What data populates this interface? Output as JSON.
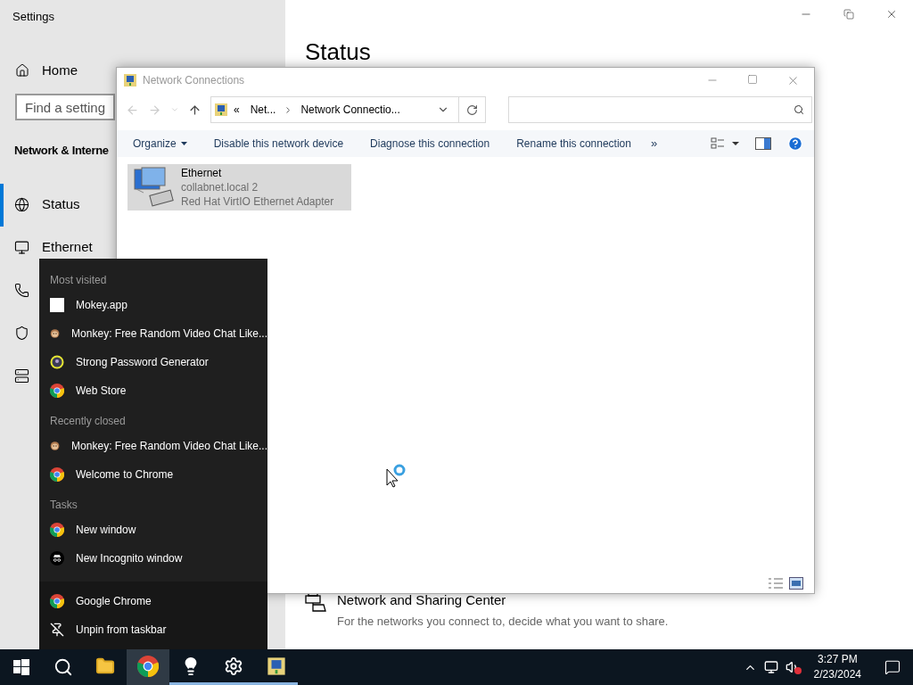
{
  "settings": {
    "title": "Settings",
    "home": "Home",
    "search": {
      "placeholder": "Find a setting"
    },
    "section": "Network & Interne",
    "items": [
      {
        "kind": "globe",
        "label": "Status",
        "selected": true
      },
      {
        "kind": "ethernet",
        "label": "Ethernet",
        "selected": false
      },
      {
        "kind": "dialup",
        "selected": false
      },
      {
        "kind": "vpn",
        "selected": false
      },
      {
        "kind": "proxy",
        "selected": false
      }
    ],
    "heading": "Status",
    "sharing": {
      "title": "Network and Sharing Center",
      "description": "For the networks you connect to, decide what you want to share."
    }
  },
  "network_window": {
    "title": "Network Connections",
    "address": {
      "overflow": "«",
      "crumbs": [
        "Net...",
        "Network Connectio..."
      ]
    },
    "toolbar": [
      "Organize",
      "Disable this network device",
      "Diagnose this connection",
      "Rename this connection"
    ],
    "more": "»",
    "items": [
      {
        "name": "Ethernet",
        "network": "collabnet.local 2",
        "adapter": "Red Hat VirtIO Ethernet Adapter",
        "selected": true
      }
    ]
  },
  "jump_list": {
    "sections": [
      {
        "heading": "Most visited",
        "items": [
          {
            "kind": "blank",
            "label": "Mokey.app"
          },
          {
            "kind": "monkey",
            "label": "Monkey: Free Random Video Chat Like..."
          },
          {
            "kind": "password",
            "label": "Strong Password Generator"
          },
          {
            "kind": "chrome",
            "label": "Web Store"
          }
        ]
      },
      {
        "heading": "Recently closed",
        "items": [
          {
            "kind": "monkey",
            "label": "Monkey: Free Random Video Chat Like..."
          },
          {
            "kind": "chrome",
            "label": "Welcome to Chrome"
          }
        ]
      },
      {
        "heading": "Tasks",
        "items": [
          {
            "kind": "chrome",
            "label": "New window"
          },
          {
            "kind": "incognito",
            "label": "New Incognito window"
          }
        ]
      }
    ],
    "footer": [
      {
        "kind": "chrome",
        "label": "Google Chrome"
      },
      {
        "kind": "unpin",
        "label": "Unpin from taskbar"
      }
    ]
  },
  "taskbar": {
    "apps": [
      {
        "kind": "explorer",
        "running": false,
        "active": false
      },
      {
        "kind": "chrome",
        "running": false,
        "active": true
      },
      {
        "kind": "tips",
        "running": true,
        "active": false
      },
      {
        "kind": "settings",
        "running": true,
        "active": false
      },
      {
        "kind": "netconn",
        "running": true,
        "active": false
      }
    ],
    "time": "3:27 PM",
    "date": "2/23/2024"
  }
}
